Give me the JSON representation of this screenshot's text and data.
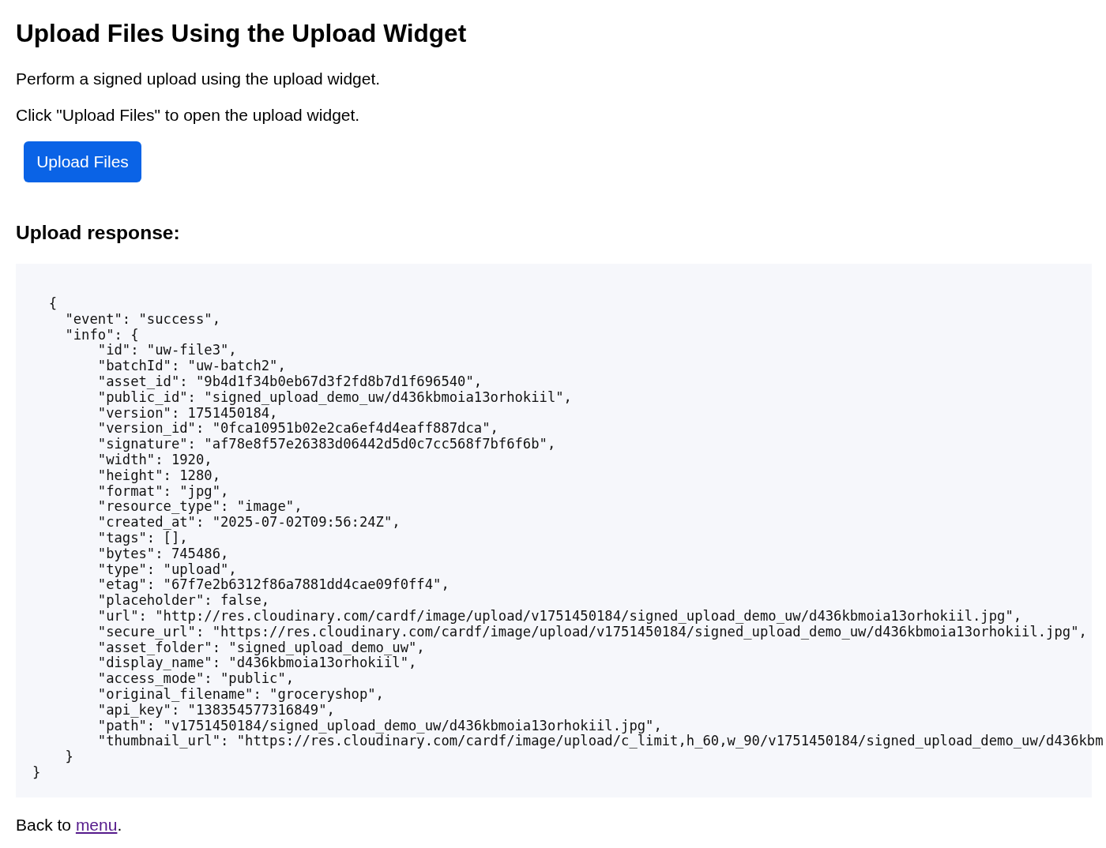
{
  "page": {
    "title": "Upload Files Using the Upload Widget"
  },
  "paragraphs": [
    "Perform a signed upload using the upload widget.",
    "Click \"Upload Files\" to open the upload widget."
  ],
  "upload_button": {
    "label": "Upload Files"
  },
  "upload_response": {
    "heading": "Upload response:",
    "code": "  {\n    \"event\": \"success\",\n    \"info\": {\n        \"id\": \"uw-file3\",\n        \"batchId\": \"uw-batch2\",\n        \"asset_id\": \"9b4d1f34b0eb67d3f2fd8b7d1f696540\",\n        \"public_id\": \"signed_upload_demo_uw/d436kbmoia13orhokiil\",\n        \"version\": 1751450184,\n        \"version_id\": \"0fca10951b02e2ca6ef4d4eaff887dca\",\n        \"signature\": \"af78e8f57e26383d06442d5d0c7cc568f7bf6f6b\",\n        \"width\": 1920,\n        \"height\": 1280,\n        \"format\": \"jpg\",\n        \"resource_type\": \"image\",\n        \"created_at\": \"2025-07-02T09:56:24Z\",\n        \"tags\": [],\n        \"bytes\": 745486,\n        \"type\": \"upload\",\n        \"etag\": \"67f7e2b6312f86a7881dd4cae09f0ff4\",\n        \"placeholder\": false,\n        \"url\": \"http://res.cloudinary.com/cardf/image/upload/v1751450184/signed_upload_demo_uw/d436kbmoia13orhokiil.jpg\",\n        \"secure_url\": \"https://res.cloudinary.com/cardf/image/upload/v1751450184/signed_upload_demo_uw/d436kbmoia13orhokiil.jpg\",\n        \"asset_folder\": \"signed_upload_demo_uw\",\n        \"display_name\": \"d436kbmoia13orhokiil\",\n        \"access_mode\": \"public\",\n        \"original_filename\": \"groceryshop\",\n        \"api_key\": \"138354577316849\",\n        \"path\": \"v1751450184/signed_upload_demo_uw/d436kbmoia13orhokiil.jpg\",\n        \"thumbnail_url\": \"https://res.cloudinary.com/cardf/image/upload/c_limit,h_60,w_90/v1751450184/signed_upload_demo_uw/d436kbm\n    }\n}"
  },
  "footer": {
    "before": "Back to",
    "link": "menu",
    "after": "."
  }
}
